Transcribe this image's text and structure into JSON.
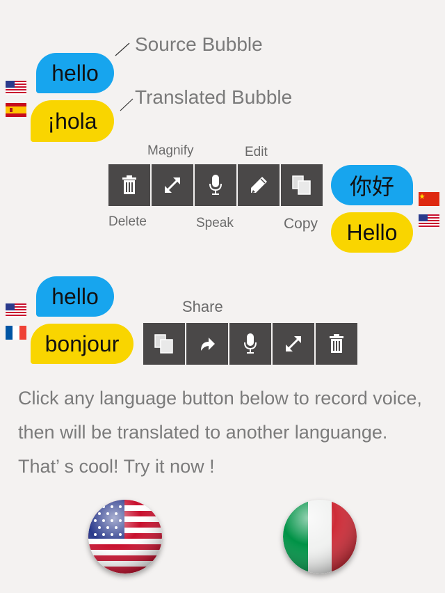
{
  "annotations": {
    "source": "Source Bubble",
    "translated": "Translated Bubble"
  },
  "row1": {
    "source_text": "hello",
    "translated_text": "¡hola",
    "source_flag": "us-flag-icon",
    "translated_flag": "spain-flag-icon"
  },
  "row2": {
    "source_text": "你好",
    "translated_text": "Hello",
    "source_flag": "china-flag-icon",
    "translated_flag": "us-flag-icon",
    "labels": {
      "magnify": "Magnify",
      "edit": "Edit",
      "delete": "Delete",
      "speak": "Speak",
      "copy": "Copy"
    },
    "tools": [
      "trash-icon",
      "expand-icon",
      "microphone-icon",
      "pencil-icon",
      "copy-icon"
    ]
  },
  "row3": {
    "source_text": "hello",
    "translated_text": "bonjour",
    "source_flag": "us-flag-icon",
    "translated_flag": "france-flag-icon",
    "labels": {
      "share": "Share"
    },
    "tools": [
      "copy-icon",
      "share-icon",
      "microphone-icon",
      "expand-icon",
      "trash-icon"
    ]
  },
  "instructions": [
    "Click any language button below to record voice,",
    "then will be translated to another languange.",
    "That’ s cool! Try it now !"
  ],
  "language_buttons": [
    {
      "name": "english-language-button",
      "icon": "us-flag-globe-icon"
    },
    {
      "name": "italian-language-button",
      "icon": "italy-flag-globe-icon"
    }
  ],
  "colors": {
    "source_bubble": "#17a5ee",
    "translated_bubble": "#f9d500",
    "toolbar": "#4a4848",
    "background": "#f4f2f1"
  }
}
